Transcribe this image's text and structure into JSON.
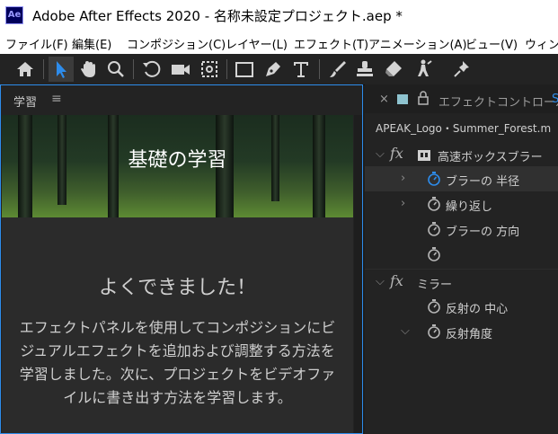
{
  "app": {
    "icon_label": "Ae",
    "title": "Adobe After Effects 2020 - 名称未設定プロジェクト.aep *"
  },
  "menu": [
    "ファイル(F)",
    "編集(E)",
    "コンポジション(C)",
    "レイヤー(L)",
    "エフェクト(T)",
    "アニメーション(A)",
    "ビュー(V)",
    "ウィンドウ"
  ],
  "toolbar": {
    "tools": [
      "home-icon",
      "selection-tool-icon",
      "hand-tool-icon",
      "zoom-tool-icon",
      "rotation-tool-icon",
      "camera-tool-icon",
      "pan-behind-tool-icon",
      "rectangle-tool-icon",
      "pen-tool-icon",
      "type-tool-icon",
      "brush-tool-icon",
      "clone-stamp-tool-icon",
      "eraser-tool-icon",
      "roto-brush-tool-icon",
      "puppet-pin-tool-icon"
    ],
    "selected": "selection-tool-icon"
  },
  "learn_panel": {
    "tab_label": "学習",
    "menu_icon": "≡",
    "hero_title": "基礎の学習",
    "done_title": "よくできました！",
    "done_text": "エフェクトパネルを使用してコンポジションにビジュアルエフェクトを追加および調整する方法を学習しました。次に、プロジェクトをビデオファイルに書き出す方法を学習します。"
  },
  "effect_controls": {
    "close_icon": "×",
    "tab_label": "エフェクトコントロール",
    "tab_extra": "S",
    "layer_name": "APEAK_Logo・Summer_Forest.m",
    "accent": "#2d8ceb",
    "rows": [
      {
        "type": "effect",
        "expanded": true,
        "label": "高速ボックスブラー"
      },
      {
        "type": "property",
        "label": "ブラーの 半径",
        "expandable": true,
        "stopwatch_active": true,
        "highlight": true
      },
      {
        "type": "property",
        "label": "繰り返し",
        "expandable": true
      },
      {
        "type": "property",
        "label": "ブラーの 方向"
      },
      {
        "type": "property",
        "label": ""
      },
      {
        "type": "effect",
        "expanded": true,
        "label": "ミラー"
      },
      {
        "type": "property",
        "label": "反射の 中心"
      },
      {
        "type": "property",
        "label": "反射角度",
        "expanded": true
      }
    ]
  }
}
